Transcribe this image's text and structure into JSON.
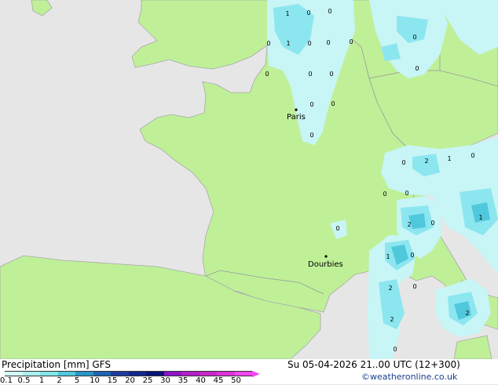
{
  "cities": [
    {
      "name": "Paris"
    },
    {
      "name": "Dourbies"
    }
  ],
  "precip_labels": [
    "1",
    "0",
    "0",
    "1",
    "0",
    "0",
    "0",
    "0",
    "0",
    "0",
    "0",
    "0",
    "0",
    "0",
    "0",
    "0",
    "2",
    "1",
    "0",
    "0",
    "0",
    "0",
    "1",
    "2",
    "0",
    "1",
    "0",
    "2",
    "0",
    "2",
    "0",
    "2",
    "0"
  ],
  "footer": {
    "title": "Precipitation [mm] GFS",
    "datetime": "Su 05-04-2026 21..00 UTC (12+300)",
    "copyright": "©weatheronline.co.uk"
  },
  "legend": {
    "ticks": [
      "0.1",
      "0.5",
      "1",
      "2",
      "5",
      "10",
      "15",
      "20",
      "25",
      "30",
      "35",
      "40",
      "45",
      "50"
    ],
    "colors": [
      "#d2f5f5",
      "#aaeeee",
      "#82e6e6",
      "#50c8dc",
      "#2896c8",
      "#1e64b4",
      "#1e3ca0",
      "#14288c",
      "#0a1478",
      "#8c14c8",
      "#b41ec8",
      "#c828c8",
      "#dc32dc",
      "#f046f0"
    ]
  },
  "colors": {
    "sea": "#e6e6e6",
    "land": "#bff098",
    "precip_light": "#c8f5f5",
    "precip_mid": "#8ce6f0",
    "precip_heavy": "#50c8dc",
    "border": "#999999"
  }
}
